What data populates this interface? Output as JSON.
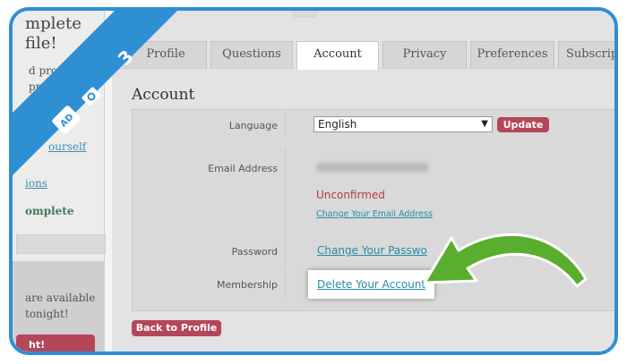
{
  "step_banner": {
    "step_number": "3",
    "brand_badge": "AD",
    "color": "#2f8fd3"
  },
  "left_column": {
    "title_line1": "mplete",
    "title_line2": "file!",
    "lines": [
      "d profile",
      "pro",
      "he"
    ],
    "link1": "ourself",
    "link2": "ions",
    "complete": "omplete",
    "promo_line1": "are available",
    "promo_line2": "tonight!",
    "promo_button": "ht!"
  },
  "tabs": [
    "Profile",
    "Questions",
    "Account",
    "Privacy",
    "Preferences",
    "Subscrip"
  ],
  "active_tab": "Account",
  "page_title": "Account",
  "rows": {
    "language_label": "Language",
    "language_value": "English",
    "update_button": "Update",
    "email_label": "Email Address",
    "unconfirmed": "Unconfirmed",
    "change_email_link": "Change Your Email Address",
    "password_label": "Password",
    "change_password_link": "Change Your Passwo",
    "membership_label": "Membership",
    "delete_account_link": "Delete Your Account"
  },
  "back_button": "Back to Profile",
  "colors": {
    "accent_button": "#b5465a",
    "link": "#2a8aa8",
    "arrow": "#5aae2e"
  }
}
